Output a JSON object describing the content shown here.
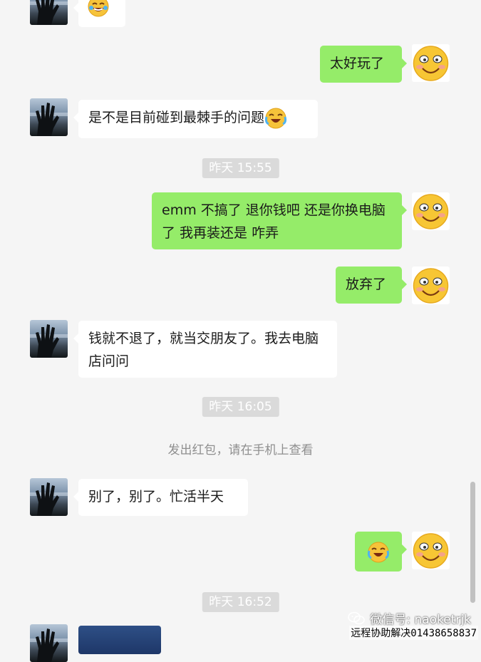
{
  "chat": {
    "messages": [
      {
        "side": "left",
        "text": "",
        "emoji_after": "laughing-emoji"
      },
      {
        "side": "right",
        "text": "太好玩了"
      },
      {
        "side": "left",
        "text": "是不是目前碰到最棘手的问题",
        "emoji_after": "crying-laughing-emoji"
      },
      {
        "type": "time",
        "text": "昨天 15:55"
      },
      {
        "side": "right",
        "text": "emm 不搞了 退你钱吧 还是你换电脑了 我再装还是 咋弄"
      },
      {
        "side": "right",
        "text": "放弃了"
      },
      {
        "side": "left",
        "text": "钱就不退了，就当交朋友了。我去电脑店问问"
      },
      {
        "type": "time",
        "text": "昨天 16:05"
      },
      {
        "type": "system",
        "text": "发出红包，请在手机上查看"
      },
      {
        "side": "left",
        "text": "别了，别了。忙活半天"
      },
      {
        "side": "right",
        "text": "",
        "emoji_after": "crying-laughing-emoji"
      },
      {
        "type": "time",
        "text": "昨天 16:52"
      },
      {
        "side": "left",
        "type": "image"
      }
    ]
  },
  "watermark": {
    "line1": "微信号: naoketrjk",
    "line2": "远程协助解决01438658837"
  },
  "icons": {
    "left_avatar": "hand-avatar",
    "right_avatar": "smiling-face-avatar",
    "watermark_icon": "wechat-icon"
  }
}
